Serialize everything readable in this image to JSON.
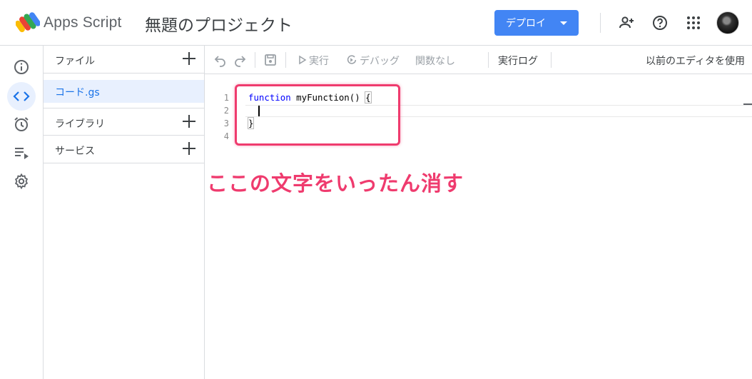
{
  "header": {
    "app_name": "Apps Script",
    "project_title": "無題のプロジェクト",
    "deploy_label": "デプロイ"
  },
  "rail": {
    "items": [
      "info-icon",
      "code-icon",
      "clock-icon",
      "executions-icon",
      "gear-icon"
    ],
    "active": "code-icon"
  },
  "files_panel": {
    "files_label": "ファイル",
    "file_name": "コード.gs",
    "libraries_label": "ライブラリ",
    "services_label": "サービス"
  },
  "toolbar": {
    "run_label": "実行",
    "debug_label": "デバッグ",
    "function_label": "関数なし",
    "log_label": "実行ログ",
    "legacy_label": "以前のエディタを使用"
  },
  "editor": {
    "line_numbers": [
      "1",
      "2",
      "3",
      "4"
    ],
    "keyword": "function",
    "signature": " myFunction() ",
    "open_brace": "{",
    "close_brace": "}"
  },
  "annotation": {
    "text": "ここの文字をいったん消す",
    "color": "#ef3b6e"
  },
  "colors": {
    "accent": "#4285f4",
    "selected_bg": "#e8f0fe",
    "link": "#1a73e8"
  }
}
